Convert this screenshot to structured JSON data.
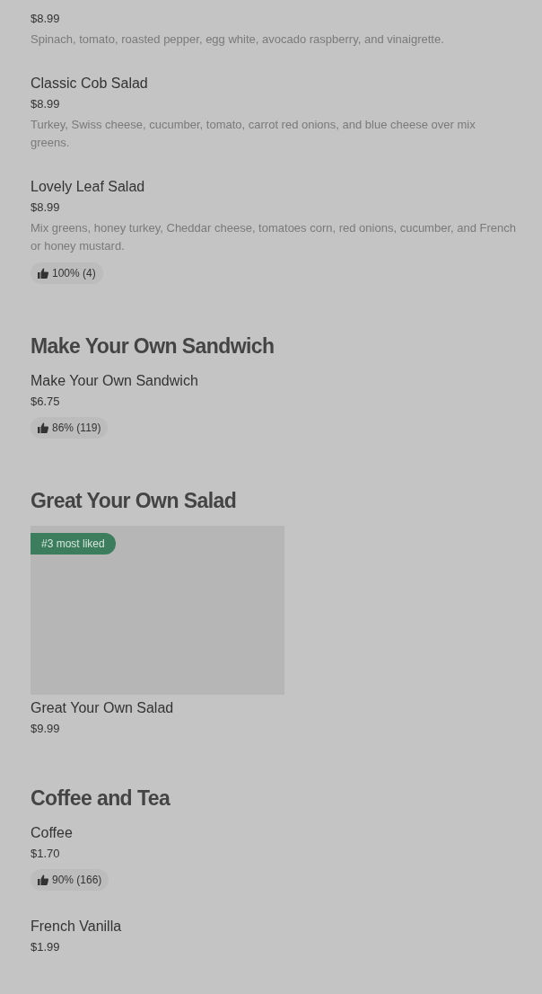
{
  "sections": [
    {
      "items": [
        {
          "price": "$8.99",
          "description": "Spinach, tomato, roasted pepper, egg white, avocado raspberry, and vinaigrette."
        },
        {
          "name": "Classic Cob Salad",
          "price": "$8.99",
          "description": "Turkey, Swiss cheese, cucumber, tomato, carrot red onions, and blue cheese over mix greens."
        },
        {
          "name": "Lovely Leaf Salad",
          "price": "$8.99",
          "description": "Mix greens, honey turkey, Cheddar cheese, tomatoes corn, red onions, cucumber, and French or honey mustard.",
          "rating": "100% (4)"
        }
      ]
    },
    {
      "title": "Make Your Own Sandwich",
      "items": [
        {
          "name": "Make Your Own Sandwich",
          "price": "$6.75",
          "rating": "86% (119)"
        }
      ]
    },
    {
      "title": "Great Your Own Salad",
      "items": [
        {
          "image": {
            "badge": "#3 most liked"
          },
          "name": "Great Your Own Salad",
          "price": "$9.99"
        }
      ]
    },
    {
      "title": "Coffee and Tea",
      "items": [
        {
          "name": "Coffee",
          "price": "$1.70",
          "rating": "90% (166)"
        },
        {
          "name": "French Vanilla",
          "price": "$1.99"
        }
      ]
    }
  ]
}
